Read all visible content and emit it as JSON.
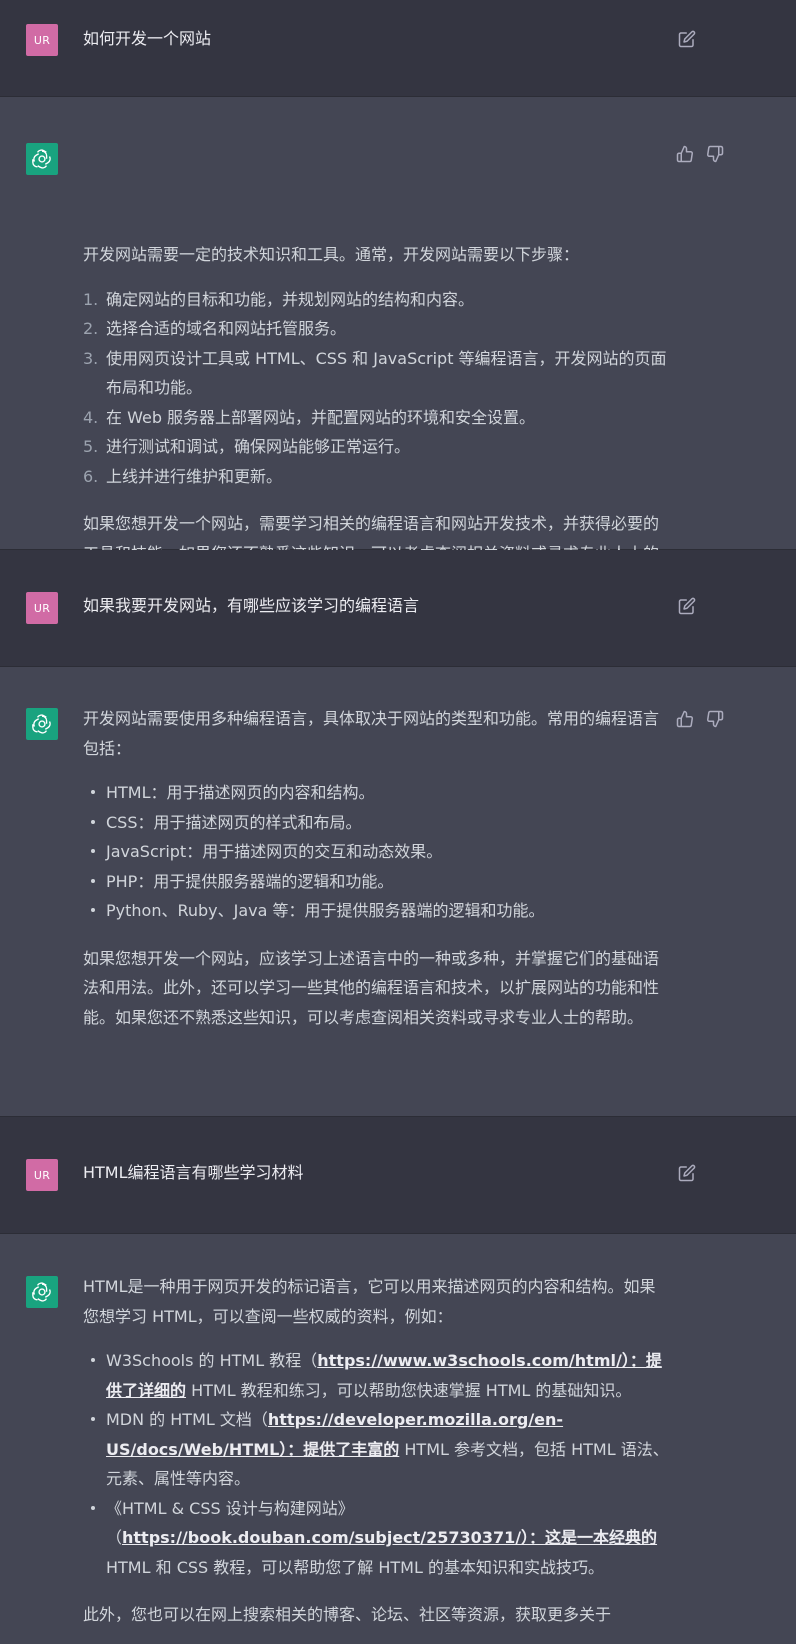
{
  "conversation": {
    "q1": {
      "avatar": "UR",
      "text": "如何开发一个网站"
    },
    "a1": {
      "intro": "开发网站需要一定的技术知识和工具。通常，开发网站需要以下步骤：",
      "steps": [
        {
          "num": "1.",
          "text": "确定网站的目标和功能，并规划网站的结构和内容。"
        },
        {
          "num": "2.",
          "text": "选择合适的域名和网站托管服务。"
        },
        {
          "num": "3.",
          "text": "使用网页设计工具或 HTML、CSS 和 JavaScript 等编程语言，开发网站的页面布局和功能。"
        },
        {
          "num": "4.",
          "text": "在 Web 服务器上部署网站，并配置网站的环境和安全设置。"
        },
        {
          "num": "5.",
          "text": "进行测试和调试，确保网站能够正常运行。"
        },
        {
          "num": "6.",
          "text": "上线并进行维护和更新。"
        }
      ],
      "outro": "如果您想开发一个网站，需要学习相关的编程语言和网站开发技术，并获得必要的工具和技能。如果您还不熟悉这些知识，可以考虑查阅相关资料或寻求专业人士的帮助。"
    },
    "q2": {
      "avatar": "UR",
      "text": "如果我要开发网站，有哪些应该学习的编程语言"
    },
    "a2": {
      "intro": "开发网站需要使用多种编程语言，具体取决于网站的类型和功能。常用的编程语言包括：",
      "bullets": [
        "HTML：用于描述网页的内容和结构。",
        "CSS：用于描述网页的样式和布局。",
        "JavaScript：用于描述网页的交互和动态效果。",
        "PHP：用于提供服务器端的逻辑和功能。",
        "Python、Ruby、Java 等：用于提供服务器端的逻辑和功能。"
      ],
      "outro": "如果您想开发一个网站，应该学习上述语言中的一种或多种，并掌握它们的基础语法和用法。此外，还可以学习一些其他的编程语言和技术，以扩展网站的功能和性能。如果您还不熟悉这些知识，可以考虑查阅相关资料或寻求专业人士的帮助。"
    },
    "q3": {
      "avatar": "UR",
      "text": "HTML编程语言有哪些学习材料"
    },
    "a3": {
      "intro": "HTML是一种用于网页开发的标记语言，它可以用来描述网页的内容和结构。如果您想学习 HTML，可以查阅一些权威的资料，例如：",
      "resources": [
        {
          "before": "W3Schools 的 HTML 教程（",
          "link": "https://www.w3schools.com/html/）：提供了详细的",
          "after": " HTML 教程和练习，可以帮助您快速掌握 HTML 的基础知识。"
        },
        {
          "before": "MDN 的 HTML 文档（",
          "link": "https://developer.mozilla.org/en-US/docs/Web/HTML）：提供了丰富的",
          "after": " HTML 参考文档，包括 HTML 语法、元素、属性等内容。"
        },
        {
          "before": "《HTML & CSS 设计与构建网站》（",
          "link": "https://book.douban.com/subject/25730371/）：这是一本经典的",
          "after": " HTML 和 CSS 教程，可以帮助您了解 HTML 的基本知识和实战技巧。"
        }
      ],
      "outro": "此外，您也可以在网上搜索相关的博客、论坛、社区等资源，获取更多关于"
    }
  },
  "icons": {
    "edit": "edit-icon",
    "thumbs_up": "thumbs-up-icon",
    "thumbs_down": "thumbs-down-icon",
    "assistant_logo": "openai-logo-icon"
  },
  "colors": {
    "user_bg": "#343541",
    "assistant_bg": "#444654",
    "user_avatar": "#d16ba5",
    "assistant_avatar": "#19a37f"
  }
}
